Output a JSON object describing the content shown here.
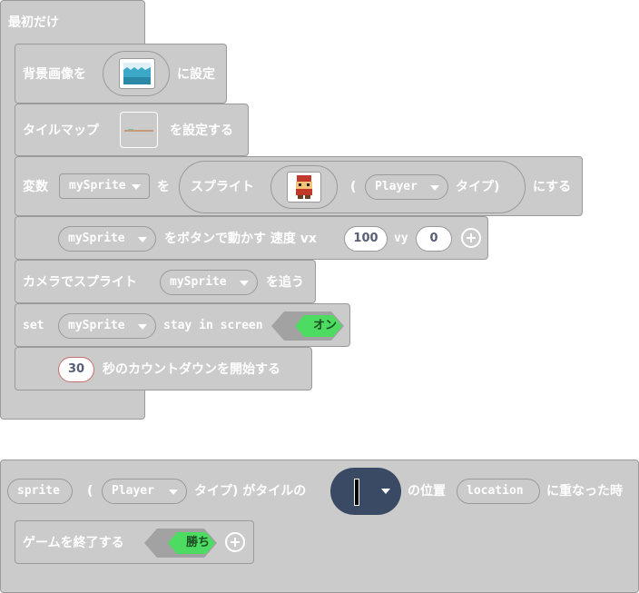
{
  "on_start": {
    "hat_label": "最初だけ",
    "set_background": {
      "label_before": "背景画像を",
      "label_after": "に設定"
    },
    "set_tilemap": {
      "label_before": "タイルマップ",
      "label_after": "を設定する"
    },
    "set_variable": {
      "label_before": "変数",
      "variable": "mySprite",
      "label_mid": "を",
      "sprite_label": "スプライト",
      "open_paren": "(",
      "kind": "Player",
      "kind_suffix": "タイプ)",
      "label_after": "にする"
    },
    "move_with_buttons": {
      "variable": "mySprite",
      "label": "をボタンで動かす 速度 vx",
      "vx": "100",
      "vy_label": "vy",
      "vy": "0"
    },
    "camera_follow": {
      "label_before": "カメラでスプライト",
      "variable": "mySprite",
      "label_after": "を追う"
    },
    "stay_in_screen": {
      "set_label": "set",
      "variable": "mySprite",
      "flag_label": "stay in screen",
      "toggle": "オン"
    },
    "countdown": {
      "seconds": "30",
      "label": "秒のカウントダウンを開始する"
    }
  },
  "overlap_event": {
    "sprite_label": "sprite",
    "open_paren": "(",
    "kind": "Player",
    "kind_suffix": "タイプ) がタイルの",
    "position_label": "の位置",
    "location_label": "location",
    "label_after": "に重なった時",
    "game_over": {
      "label": "ゲームを終了する",
      "win_value": "勝ち"
    }
  },
  "colors": {
    "block_fill": "#cbcbcb",
    "block_border": "#9a9a9a",
    "toggle_green": "#4ddc61",
    "tile_dropdown": "#3b4a64"
  }
}
